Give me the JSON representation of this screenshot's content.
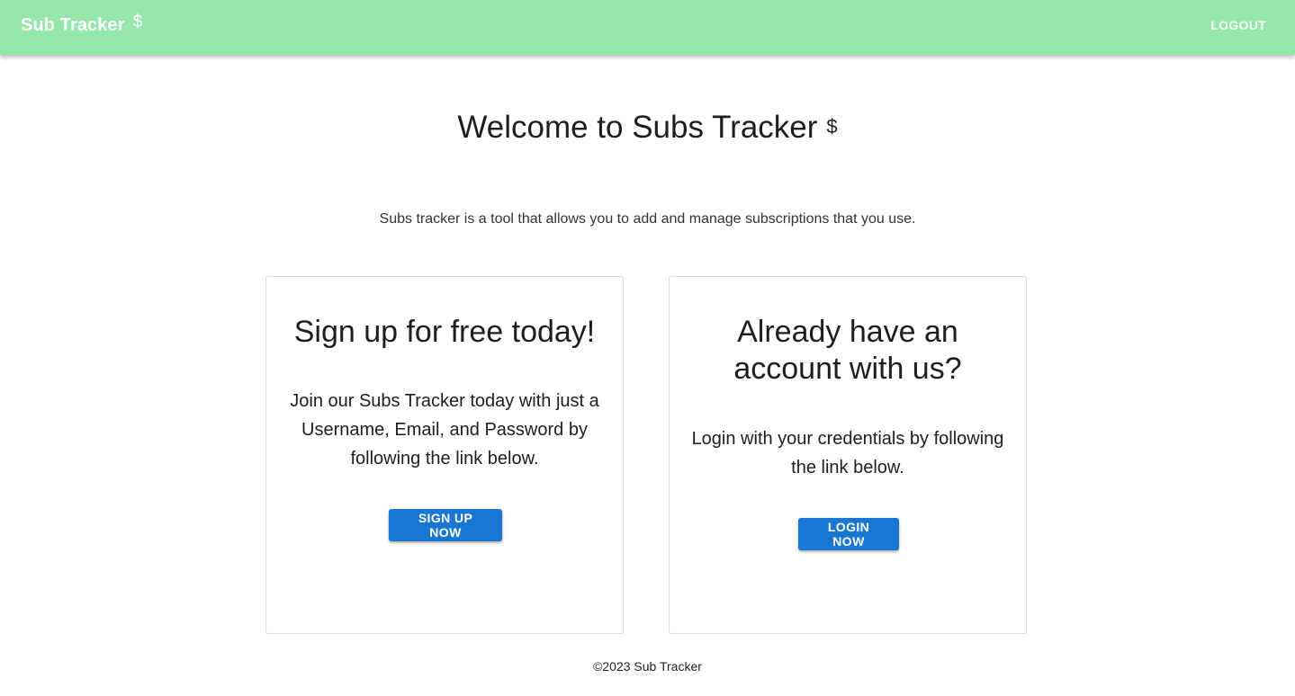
{
  "appbar": {
    "brand": "Sub Tracker",
    "brand_icon": "$",
    "logout_label": "LOGOUT",
    "background": "#94e6ab"
  },
  "hero": {
    "title": "Welcome to Subs Tracker",
    "title_icon": "$",
    "tagline": "Subs tracker is a tool that allows you to add and manage subscriptions that you use."
  },
  "cards": {
    "signup": {
      "heading": "Sign up for free today!",
      "body": "Join our Subs Tracker today with just a Username, Email, and Password by following the link below.",
      "button_label": "SIGN UP NOW"
    },
    "login": {
      "heading": "Already have an account with us?",
      "body": "Login with your credentials by following the link below.",
      "button_label": "LOGIN NOW"
    }
  },
  "accent_color": "#1976d2",
  "footer": {
    "text": "©2023 Sub Tracker"
  }
}
